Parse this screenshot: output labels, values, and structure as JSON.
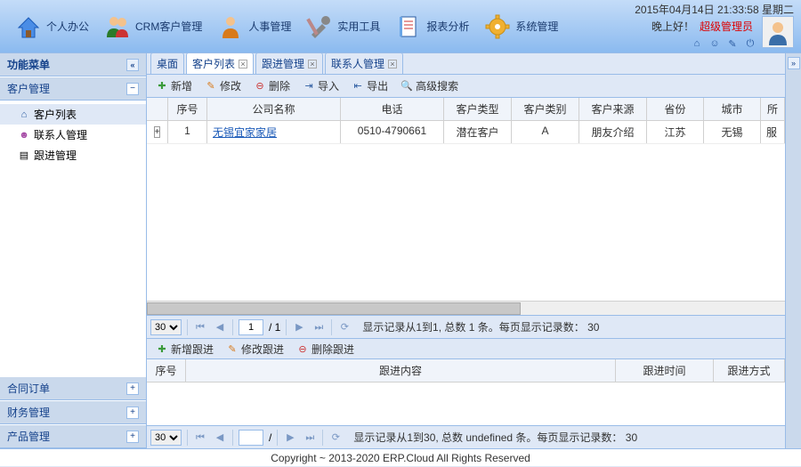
{
  "header": {
    "nav": [
      {
        "label": "个人办公"
      },
      {
        "label": "CRM客户管理"
      },
      {
        "label": "人事管理"
      },
      {
        "label": "实用工具"
      },
      {
        "label": "报表分析"
      },
      {
        "label": "系统管理"
      }
    ],
    "datetime": "2015年04月14日 21:33:58 星期二",
    "greeting": "晚上好！",
    "user_role": "超级管理员"
  },
  "sidebar": {
    "title": "功能菜单",
    "sections": [
      {
        "label": "客户管理",
        "expanded": true,
        "items": [
          {
            "label": "客户列表",
            "selected": true
          },
          {
            "label": "联系人管理"
          },
          {
            "label": "跟进管理"
          }
        ]
      },
      {
        "label": "合同订单"
      },
      {
        "label": "财务管理"
      },
      {
        "label": "产品管理"
      }
    ]
  },
  "tabs": [
    {
      "label": "桌面",
      "closable": false
    },
    {
      "label": "客户列表",
      "closable": true,
      "active": true
    },
    {
      "label": "跟进管理",
      "closable": true
    },
    {
      "label": "联系人管理",
      "closable": true
    }
  ],
  "toolbar": {
    "add": "新增",
    "edit": "修改",
    "delete": "删除",
    "import": "导入",
    "export": "导出",
    "advsearch": "高级搜索"
  },
  "grid": {
    "columns": [
      "",
      "序号",
      "公司名称",
      "电话",
      "客户类型",
      "客户类别",
      "客户来源",
      "省份",
      "城市",
      "所"
    ],
    "col_last_full": "所属",
    "rows": [
      {
        "seq": "1",
        "company": "无锡宜家家居",
        "phone": "0510-4790661",
        "ctype": "潜在客户",
        "cclass": "A",
        "source": "朋友介绍",
        "province": "江苏",
        "city": "无锡",
        "last": "服"
      }
    ]
  },
  "pager1": {
    "page_size": "30",
    "page": "1",
    "total_pages": "1",
    "info": "显示记录从1到1, 总数 1 条。每页显示记录数：",
    "info_n": "30"
  },
  "sub_toolbar": {
    "add": "新增跟进",
    "edit": "修改跟进",
    "delete": "删除跟进"
  },
  "subgrid": {
    "columns": [
      "序号",
      "跟进内容",
      "跟进时间",
      "跟进方式"
    ]
  },
  "pager2": {
    "page_size": "30",
    "page": "",
    "info": "显示记录从1到30, 总数 undefined 条。每页显示记录数：",
    "info_n": "30"
  },
  "footer": "Copyright ~ 2013-2020 ERP.Cloud All Rights Reserved"
}
